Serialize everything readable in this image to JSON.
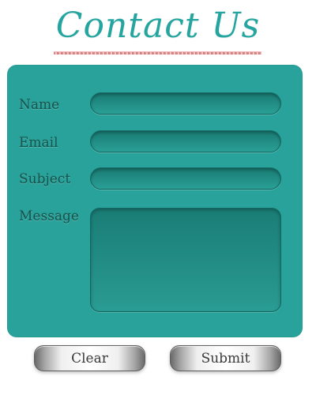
{
  "header": {
    "title": "Contact Us"
  },
  "form": {
    "fields": [
      {
        "label": "Name",
        "value": "",
        "placeholder": ""
      },
      {
        "label": "Email",
        "value": "",
        "placeholder": ""
      },
      {
        "label": "Subject",
        "value": "",
        "placeholder": ""
      },
      {
        "label": "Message",
        "value": "",
        "placeholder": ""
      }
    ]
  },
  "buttons": {
    "clear_label": "Clear",
    "submit_label": "Submit"
  },
  "colors": {
    "accent": "#28a29a",
    "label": "#17554f",
    "button_text": "#3b3b3b"
  }
}
